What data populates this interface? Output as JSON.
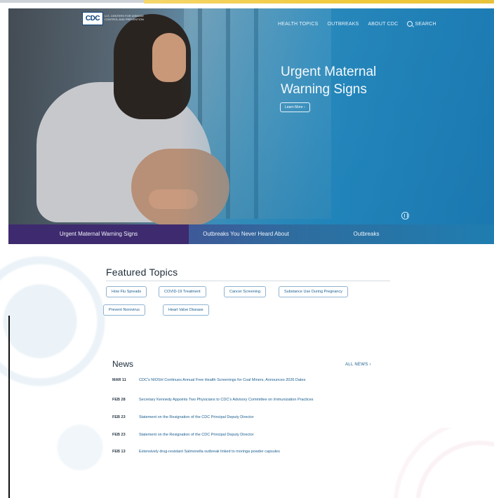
{
  "colors": {
    "accent": "#1a5d8f",
    "tab_active": "#3e2a6e",
    "hero_blue": "#2f86b4"
  },
  "header": {
    "logo": "CDC",
    "logo_subtext": "U.S. CENTERS FOR DISEASE CONTROL AND PREVENTION",
    "nav": [
      "HEALTH TOPICS",
      "OUTBREAKS",
      "ABOUT CDC",
      "SEARCH"
    ]
  },
  "hero": {
    "title": "Urgent Maternal Warning Signs",
    "button": "Learn More ›"
  },
  "tabs": [
    "Urgent Maternal Warning Signs",
    "Outbreaks You Never Heard About",
    "Outbreaks"
  ],
  "featured": {
    "title": "Featured Topics",
    "topics": [
      "How Flu Spreads",
      "COVID-19 Treatment",
      "Cancer Screening",
      "Substance Use During Pregnancy",
      "Prevent Norovirus",
      "Heart Valve Disease"
    ]
  },
  "news": {
    "title": "News",
    "all_label": "ALL NEWS ›",
    "items": [
      {
        "date": "MAR 11",
        "headline": "CDC's NIOSH Continues Annual Free Health Screenings for Coal Miners, Announces 2026 Dates"
      },
      {
        "date": "FEB 28",
        "headline": "Secretary Kennedy Appoints Two Physicians to CDC's Advisory Committee on Immunization Practices"
      },
      {
        "date": "FEB 23",
        "headline": "Statement on the Resignation of the CDC Principal Deputy Director"
      },
      {
        "date": "FEB 23",
        "headline": "Statement on the Resignation of the CDC Principal Deputy Director"
      },
      {
        "date": "FEB 13",
        "headline": "Extensively drug-resistant Salmonella outbreak linked to moringa powder capsules"
      }
    ]
  }
}
